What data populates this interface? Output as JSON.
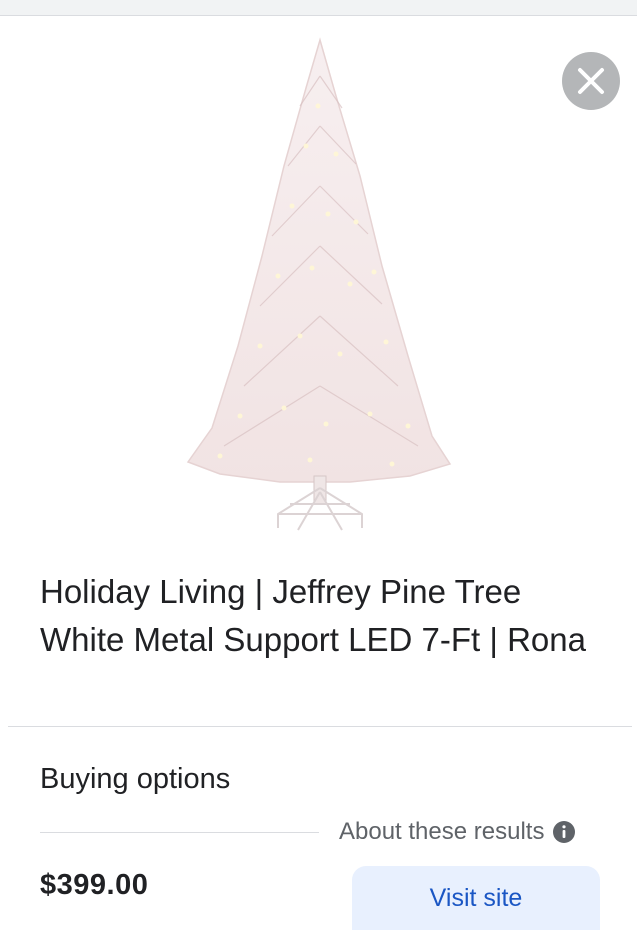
{
  "product": {
    "title": "Holiday Living | Jeffrey Pine Tree White Metal Support LED 7-Ft | Rona",
    "image_icon": "white-christmas-tree-image"
  },
  "controls": {
    "close_icon": "close-icon"
  },
  "buying_options": {
    "heading": "Buying options",
    "about_label": "About these results",
    "info_icon": "info-icon",
    "offers": [
      {
        "price": "$399.00",
        "visit_label": "Visit site"
      }
    ]
  },
  "colors": {
    "close_bg": "#b4b6b8",
    "link_blue": "#1a56c4",
    "button_bg": "#e8f0fe",
    "text_primary": "#202124",
    "text_secondary": "#5f6368",
    "divider": "#dadce0"
  }
}
